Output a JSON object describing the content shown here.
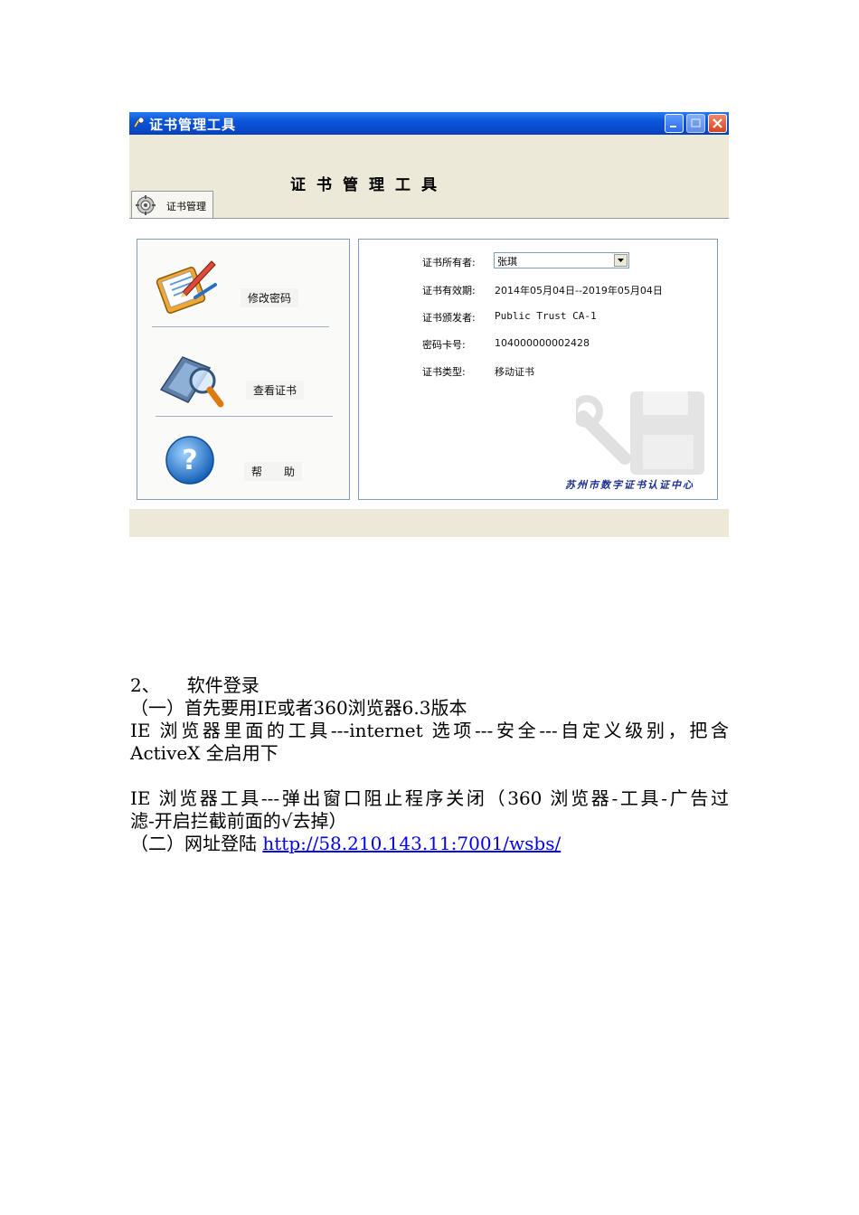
{
  "window": {
    "title": "证书管理工具",
    "heading": "证书管理工具",
    "tab_label": "证书管理",
    "menu": [
      {
        "label": "修改密码",
        "icon": "clipboard-pencil-icon"
      },
      {
        "label": "查看证书",
        "icon": "magnifier-certificate-icon"
      },
      {
        "label": "帮　　助",
        "icon": "help-icon"
      }
    ],
    "info": {
      "owner_label": "证书所有者:",
      "owner_value": "张琪",
      "validity_label": "证书有效期:",
      "validity_value": "2014年05月04日--2019年05月04日",
      "issuer_label": "证书颁发者:",
      "issuer_value": "Public Trust CA-1",
      "card_label": "密码卡号:",
      "card_value": "104000000002428",
      "type_label": "证书类型:",
      "type_value": "移动证书"
    },
    "center_name": "苏州市数字证书认证中心",
    "colors": {
      "titlebar": "#0a55d8",
      "window_bg": "#ece9d8",
      "center_name": "#1c2f8f"
    }
  },
  "document": {
    "section_number": "2、",
    "section_title": "软件登录",
    "step1": "（一）首先要用IE或者360浏览器6.3版本",
    "line2a": "IE 浏览器里面的工具---internet 选项---安全---自定义级别，把含",
    "line2b": "ActiveX 全启用下",
    "line3a": "IE 浏览器工具---弹出窗口阻止程序关闭（360 浏览器-工具-广告过",
    "line3b": "滤-开启拦截前面的√去掉）",
    "step2_prefix": "（二）网址登陆 ",
    "step2_link": "http://58.210.143.11:7001/wsbs/"
  }
}
